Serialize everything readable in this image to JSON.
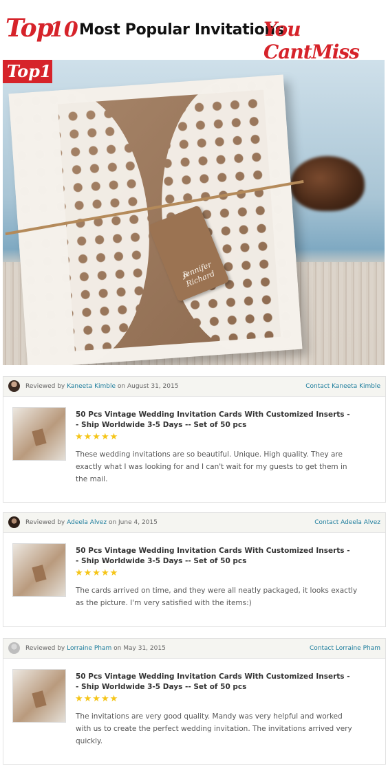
{
  "header": {
    "top": "Top",
    "ten": "10",
    "main": "Most Popular Invitations",
    "you_cant_miss": "You CantMiss"
  },
  "hero": {
    "badge": "Top1",
    "tag_line1": "Jennifer",
    "tag_line2": "& Richard"
  },
  "reviews": [
    {
      "reviewed_by": "Reviewed by",
      "reviewer": "Kaneeta Kimble",
      "on": "on",
      "date": "August 31, 2015",
      "contact": "Contact Kaneeta Kimble",
      "title": "50 Pcs Vintage Wedding Invitation Cards With Customized Inserts -- Ship Worldwide 3-5 Days -- Set of 50 pcs",
      "stars": "★★★★★",
      "rating": 5,
      "body": "These wedding invitations are so beautiful. Unique. High quality. They are exactly what I was looking for and I can't wait for my guests to get them in the mail."
    },
    {
      "reviewed_by": "Reviewed by",
      "reviewer": "Adeela Alvez",
      "on": "on",
      "date": "June 4, 2015",
      "contact": "Contact Adeela Alvez",
      "title": "50 Pcs Vintage Wedding Invitation Cards With Customized Inserts -- Ship Worldwide 3-5 Days -- Set of 50 pcs",
      "stars": "★★★★★",
      "rating": 5,
      "body": "The cards arrived on time, and they were all neatly packaged, it looks exactly as the picture. I'm very satisfied with the items:)"
    },
    {
      "reviewed_by": "Reviewed by",
      "reviewer": "Lorraine Pham",
      "on": "on",
      "date": "May 31, 2015",
      "contact": "Contact Lorraine Pham",
      "title": "50 Pcs Vintage Wedding Invitation Cards With Customized Inserts -- Ship Worldwide 3-5 Days -- Set of 50 pcs",
      "stars": "★★★★★",
      "rating": 5,
      "body": "The invitations are very good quality. Mandy was very helpful and worked with us to create the perfect wedding invitation. The invitations arrived very quickly."
    }
  ],
  "colors": {
    "accent_red": "#d6232a",
    "link_blue": "#1b7c9c",
    "star_yellow": "#f5c518"
  }
}
